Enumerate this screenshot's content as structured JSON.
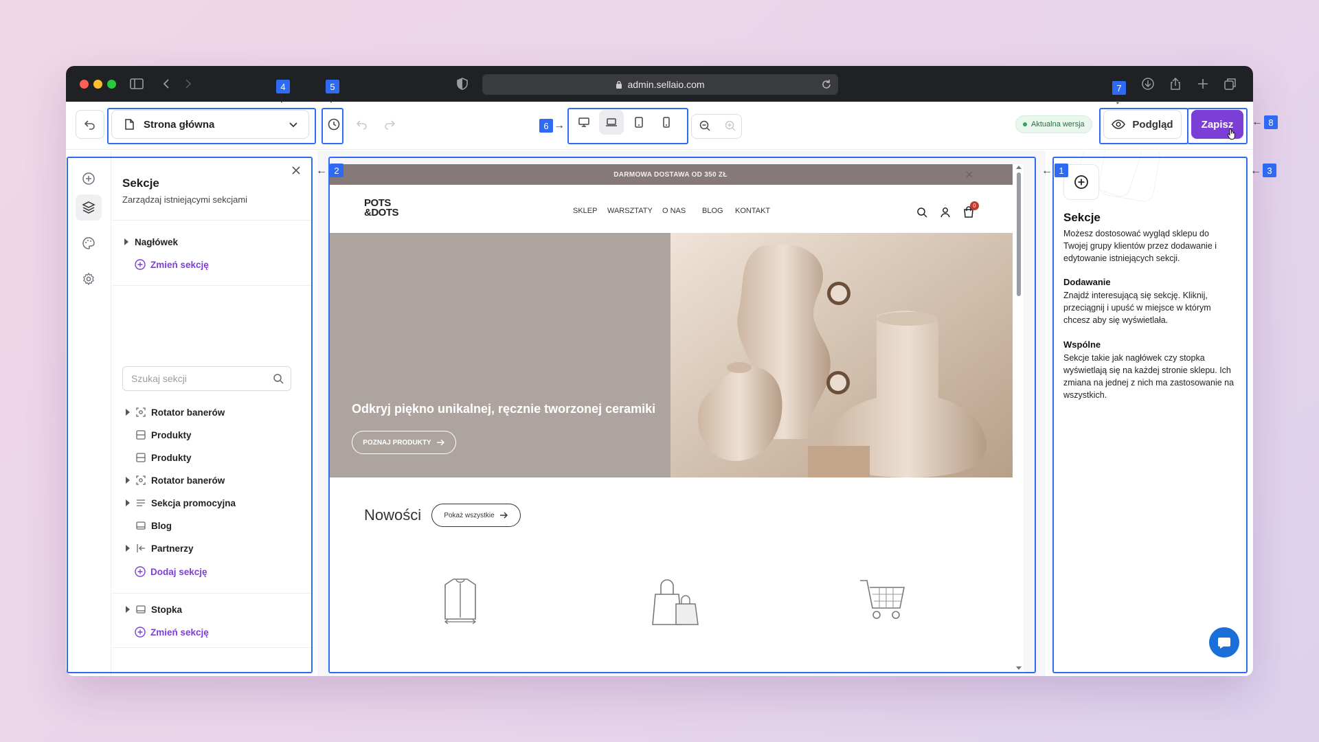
{
  "browser": {
    "url": "admin.sellaio.com"
  },
  "toolbar": {
    "page_select": "Strona główna",
    "status_badge": "Aktualna wersja",
    "preview_label": "Podgląd",
    "save_label": "Zapisz"
  },
  "annotations": {
    "n1": "1",
    "n2": "2",
    "n3": "3",
    "n4": "4",
    "n5": "5",
    "n6": "6",
    "n7": "7",
    "n8": "8"
  },
  "sidebar": {
    "title": "Sekcje",
    "subtitle": "Zarządzaj istniejącymi sekcjami",
    "header_item": "Nagłówek",
    "change_section_1": "Zmień sekcję",
    "search_placeholder": "Szukaj sekcji",
    "items": [
      {
        "label": "Rotator banerów",
        "icon": "rotator-icon",
        "expandable": true
      },
      {
        "label": "Produkty",
        "icon": "products-icon",
        "expandable": false
      },
      {
        "label": "Produkty",
        "icon": "products-icon",
        "expandable": false
      },
      {
        "label": "Rotator banerów",
        "icon": "rotator-icon",
        "expandable": true
      },
      {
        "label": "Sekcja promocyjna",
        "icon": "promo-icon",
        "expandable": true
      },
      {
        "label": "Blog",
        "icon": "blog-icon",
        "expandable": false
      },
      {
        "label": "Partnerzy",
        "icon": "partners-icon",
        "expandable": true
      }
    ],
    "add_section": "Dodaj sekcję",
    "footer_item": "Stopka",
    "change_section_2": "Zmień sekcję"
  },
  "shop": {
    "promo_bar": "DARMOWA DOSTAWA OD 350 ZŁ",
    "logo_line1": "POTS",
    "logo_line2": "&DOTS",
    "nav": [
      "SKLEP",
      "WARSZTATY",
      "O NAS",
      "BLOG",
      "KONTAKT"
    ],
    "cart_count": "0",
    "hero_title": "Odkryj piękno unikalnej, ręcznie tworzonej ceramiki",
    "hero_button": "POZNAJ PRODUKTY",
    "new_heading": "Nowości",
    "show_all": "Pokaż wszystkie"
  },
  "help": {
    "title": "Sekcje",
    "intro": "Możesz dostosować wygląd sklepu do Twojej grupy klientów przez dodawanie i edytowanie istniejących sekcji.",
    "adding_title": "Dodawanie",
    "adding_text": "Znajdź interesującą się sekcję. Kliknij, przeciągnij i upuść w miejsce w którym chcesz aby się wyświetlała.",
    "common_title": "Wspólne",
    "common_text": "Sekcje takie jak nagłówek czy stopka wyświetlają się na każdej stronie sklepu. Ich zmiana na jednej z nich ma zastosowanie na wszystkich."
  },
  "colors": {
    "accent": "#7c3fd6",
    "annotation": "#2f6bf2",
    "badge_green": "#2fa45b"
  }
}
